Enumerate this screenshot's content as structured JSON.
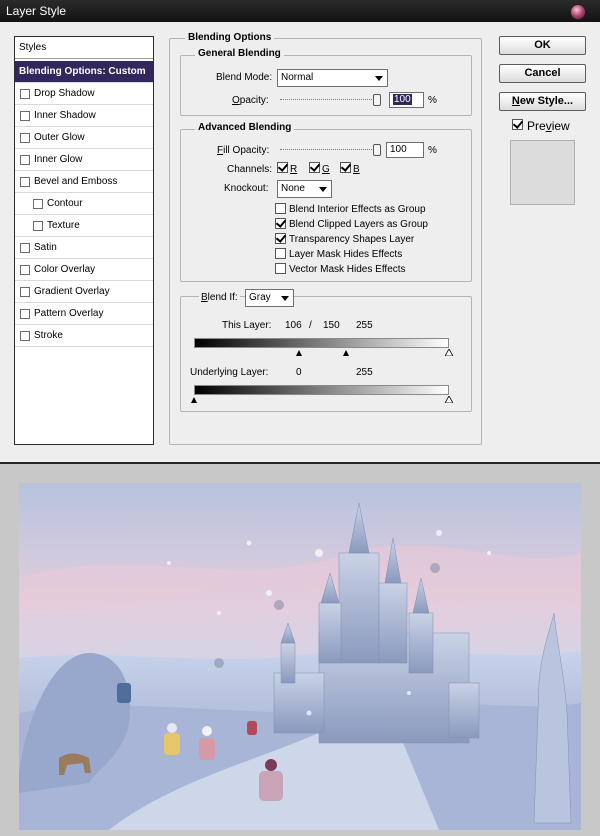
{
  "window": {
    "title": "Layer Style"
  },
  "styles_panel": {
    "header": "Styles",
    "selected": "Blending Options: Custom",
    "items": [
      {
        "label": "Drop Shadow",
        "checked": false,
        "sub": false
      },
      {
        "label": "Inner Shadow",
        "checked": false,
        "sub": false
      },
      {
        "label": "Outer Glow",
        "checked": false,
        "sub": false
      },
      {
        "label": "Inner Glow",
        "checked": false,
        "sub": false
      },
      {
        "label": "Bevel and Emboss",
        "checked": false,
        "sub": false
      },
      {
        "label": "Contour",
        "checked": false,
        "sub": true
      },
      {
        "label": "Texture",
        "checked": false,
        "sub": true
      },
      {
        "label": "Satin",
        "checked": false,
        "sub": false
      },
      {
        "label": "Color Overlay",
        "checked": false,
        "sub": false
      },
      {
        "label": "Gradient Overlay",
        "checked": false,
        "sub": false
      },
      {
        "label": "Pattern Overlay",
        "checked": false,
        "sub": false
      },
      {
        "label": "Stroke",
        "checked": false,
        "sub": false
      }
    ]
  },
  "blending_options": {
    "title": "Blending Options",
    "general": {
      "title": "General Blending",
      "blend_mode_label": "Blend Mode:",
      "blend_mode_value": "Normal",
      "opacity_label": "Opacity:",
      "opacity_value": "100",
      "opacity_level": 1.0,
      "percent": "%"
    },
    "advanced": {
      "title": "Advanced Blending",
      "fill_opacity_label": "Fill Opacity:",
      "fill_opacity_value": "100",
      "fill_opacity_level": 1.0,
      "percent": "%",
      "channels_label": "Channels:",
      "channel_r": "R",
      "channel_g": "G",
      "channel_b": "B",
      "knockout_label": "Knockout:",
      "knockout_value": "None",
      "options": [
        {
          "label": "Blend Interior Effects as Group",
          "checked": false
        },
        {
          "label": "Blend Clipped Layers as Group",
          "checked": true
        },
        {
          "label": "Transparency Shapes Layer",
          "checked": true
        },
        {
          "label": "Layer Mask Hides Effects",
          "checked": false
        },
        {
          "label": "Vector Mask Hides Effects",
          "checked": false
        }
      ]
    },
    "blend_if": {
      "label": "Blend If:",
      "value": "Gray",
      "this_layer_label": "This Layer:",
      "this_layer_low": "106",
      "this_layer_sep": "/",
      "this_layer_split": "150",
      "this_layer_high": "255",
      "underlying_label": "Underlying Layer:",
      "underlying_low": "0",
      "underlying_high": "255"
    }
  },
  "buttons": {
    "ok": "OK",
    "cancel": "Cancel",
    "new_style": "New Style...",
    "preview_label": "Preview",
    "preview_checked": true
  },
  "colors": {
    "selection": "#32265c",
    "titlebar": "#1a1a1a",
    "dialog_bg": "#eeeeee"
  }
}
